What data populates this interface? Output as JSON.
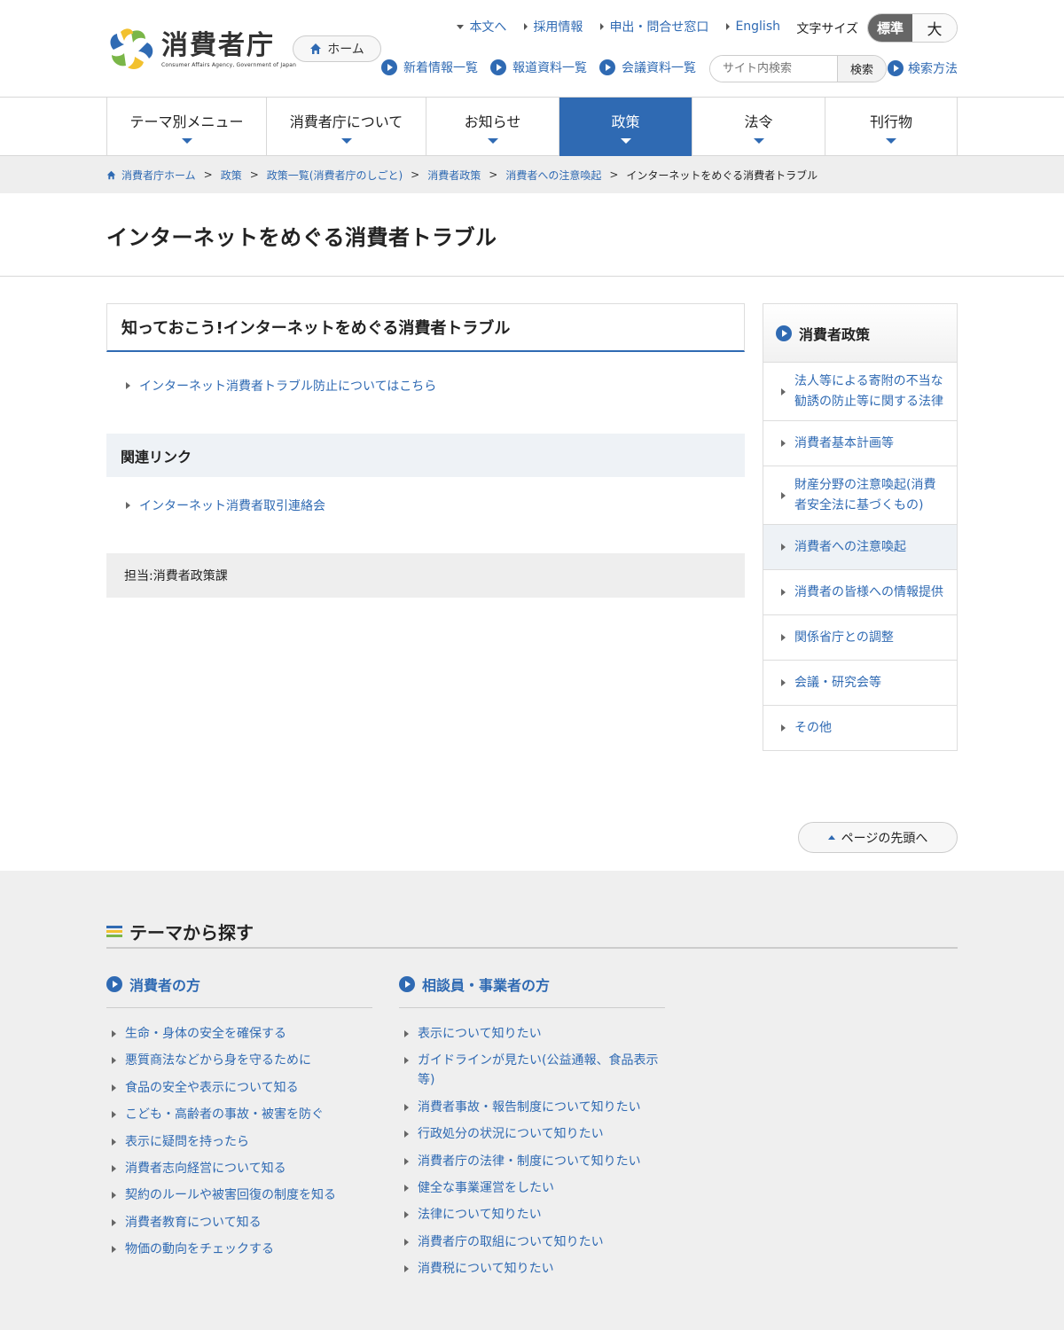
{
  "header": {
    "logo_jp": "消費者庁",
    "logo_en": "Consumer Affairs Agency, Government of Japan",
    "home": "ホーム",
    "util": [
      "本文へ",
      "採用情報",
      "申出・問合せ窓口",
      "English"
    ],
    "font_size_label": "文字サイズ",
    "font_size_standard": "標準",
    "font_size_large": "大",
    "sub_links": [
      "新着情報一覧",
      "報道資料一覧",
      "会議資料一覧"
    ],
    "search_placeholder": "サイト内検索",
    "search_button": "検索",
    "search_help": "検索方法"
  },
  "gnav": [
    "テーマ別メニュー",
    "消費者庁について",
    "お知らせ",
    "政策",
    "法令",
    "刊行物"
  ],
  "breadcrumb": [
    "消費者庁ホーム",
    "政策",
    "政策一覧(消費者庁のしごと)",
    "消費者政策",
    "消費者への注意喚起"
  ],
  "breadcrumb_current": "インターネットをめぐる消費者トラブル",
  "page_title": "インターネットをめぐる消費者トラブル",
  "content": {
    "heading": "知っておこう!インターネットをめぐる消費者トラブル",
    "link1": "インターネット消費者トラブル防止についてはこちら",
    "related_heading": "関連リンク",
    "related_link": "インターネット消費者取引連絡会",
    "contact": "担当:消費者政策課"
  },
  "side": {
    "heading": "消費者政策",
    "items": [
      "法人等による寄附の不当な勧誘の防止等に関する法律",
      "消費者基本計画等",
      "財産分野の注意喚起(消費者安全法に基づくもの)",
      "消費者への注意喚起",
      "消費者の皆様への情報提供",
      "関係省庁との調整",
      "会議・研究会等",
      "その他"
    ]
  },
  "pagetop": "ページの先頭へ",
  "themes": {
    "heading": "テーマから探す",
    "consumer": {
      "heading": "消費者の方",
      "items": [
        "生命・身体の安全を確保する",
        "悪質商法などから身を守るために",
        "食品の安全や表示について知る",
        "こども・高齢者の事故・被害を防ぐ",
        "表示に疑問を持ったら",
        "消費者志向経営について知る",
        "契約のルールや被害回復の制度を知る",
        "消費者教育について知る",
        "物価の動向をチェックする"
      ]
    },
    "business": {
      "heading": "相談員・事業者の方",
      "items": [
        "表示について知りたい",
        "ガイドラインが見たい(公益通報、食品表示等)",
        "消費者事故・報告制度について知りたい",
        "行政処分の状況について知りたい",
        "消費者庁の法律・制度について知りたい",
        "健全な事業運営をしたい",
        "法律について知りたい",
        "消費者庁の取組について知りたい",
        "消費税について知りたい"
      ]
    }
  },
  "colors": {
    "accent": "#2f6ab3",
    "logo_yellow": "#f2c12e",
    "logo_green": "#7ab648",
    "logo_blue": "#2f6ab3"
  }
}
